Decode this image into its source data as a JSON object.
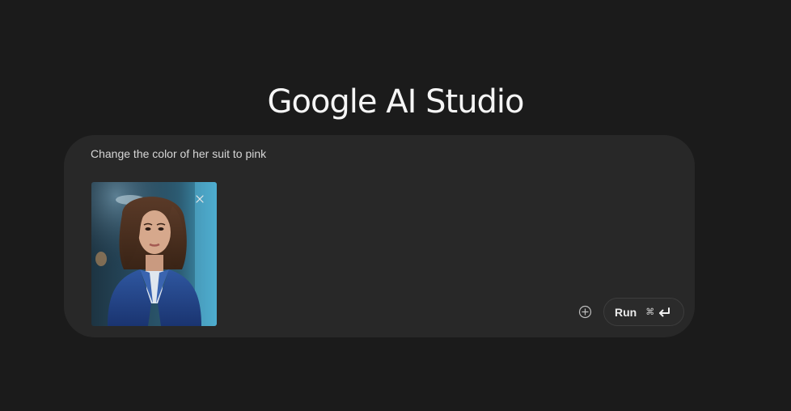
{
  "logo": {
    "text": "Google AI Studio"
  },
  "prompt": {
    "text": "Change the color of her suit to pink",
    "attachment": {
      "type": "image",
      "subject": "woman-in-blue-suit",
      "close_icon": "close-icon"
    }
  },
  "toolbar": {
    "add_icon": "add-circle-icon",
    "run_label": "Run",
    "shortcut_cmd": "⌘",
    "shortcut_enter_icon": "enter-arrow-icon"
  },
  "colors": {
    "background": "#1b1b1b",
    "card": "#282828",
    "text": "#d7d7d7",
    "logo": "#f5f5f5"
  }
}
